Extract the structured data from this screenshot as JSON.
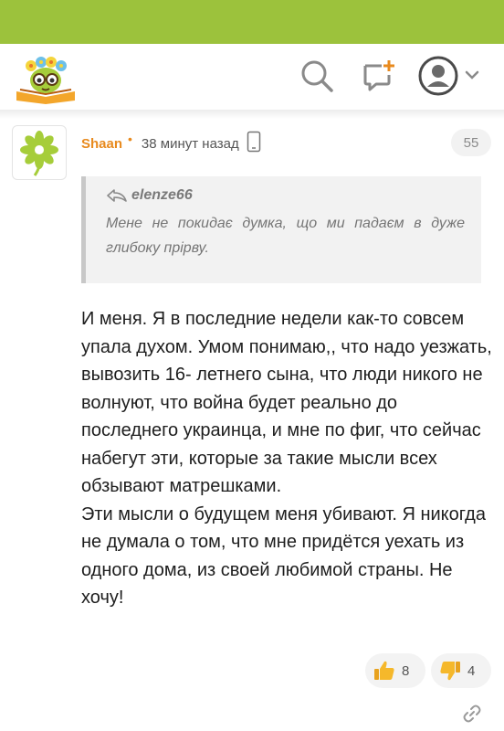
{
  "header": {
    "logo_icon": "flower-books-logo",
    "search_icon": "search-icon",
    "compose_icon": "compose-icon",
    "user_icon": "user-avatar-icon",
    "accent": "#9cc23c"
  },
  "comment": {
    "author": "Shaan",
    "time": "38 минут назад",
    "device_icon": "mobile-phone-icon",
    "number": "55",
    "quote": {
      "author": "elenze66",
      "text": "Мене не покидає думка, що ми падаєм в дуже глибоку прірву."
    },
    "paragraphs": [
      "И меня. Я в последние недели как-то совсем упала духом. Умом понимаю,, что надо уезжать, вывозить 16- летнего сына, что люди никого не волнуют, что война будет реально до последнего украинца, и мне по фиг, что сейчас набегут эти, которые за такие мысли всех обзывают матрешками.",
      "Эти мысли о будущем меня убивают. Я никогда не думала о том, что мне придётся уехать из одного дома, из своей любимой страны. Не хочу!"
    ],
    "likes": "8",
    "dislikes": "4"
  }
}
